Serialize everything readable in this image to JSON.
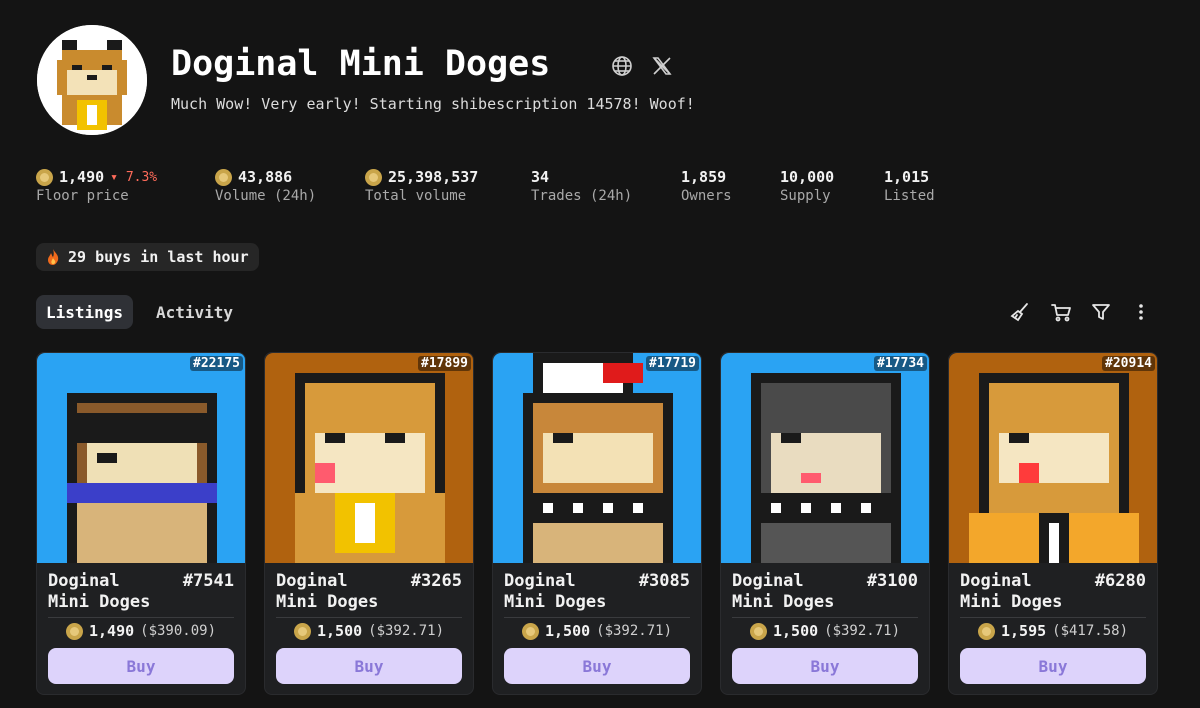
{
  "collection": {
    "title": "Doginal Mini Doges",
    "description": "Much Wow! Very early! Starting shibescription 14578! Woof!"
  },
  "stats": {
    "floor": {
      "value": "1,490",
      "delta": "7.3%",
      "label": "Floor price"
    },
    "volume24": {
      "value": "43,886",
      "label": "Volume (24h)"
    },
    "total_volume": {
      "value": "25,398,537",
      "label": "Total volume"
    },
    "trades": {
      "value": "34",
      "label": "Trades (24h)"
    },
    "owners": {
      "value": "1,859",
      "label": "Owners"
    },
    "supply": {
      "value": "10,000",
      "label": "Supply"
    },
    "listed": {
      "value": "1,015",
      "label": "Listed"
    }
  },
  "buys_pill": "29 buys in last hour",
  "tabs": {
    "listings": "Listings",
    "activity": "Activity"
  },
  "listings": [
    {
      "inscription": "#22175",
      "name": "Doginal Mini Doges",
      "number": "#7541",
      "price": "1,490",
      "usd": "($390.09)",
      "buy": "Buy"
    },
    {
      "inscription": "#17899",
      "name": "Doginal Mini Doges",
      "number": "#3265",
      "price": "1,500",
      "usd": "($392.71)",
      "buy": "Buy"
    },
    {
      "inscription": "#17719",
      "name": "Doginal Mini Doges",
      "number": "#3085",
      "price": "1,500",
      "usd": "($392.71)",
      "buy": "Buy"
    },
    {
      "inscription": "#17734",
      "name": "Doginal Mini Doges",
      "number": "#3100",
      "price": "1,500",
      "usd": "($392.71)",
      "buy": "Buy"
    },
    {
      "inscription": "#20914",
      "name": "Doginal Mini Doges",
      "number": "#6280",
      "price": "1,595",
      "usd": "($417.58)",
      "buy": "Buy"
    }
  ],
  "icons": [
    "globe-icon",
    "x-icon",
    "sweep-icon",
    "cart-icon",
    "filter-icon",
    "more-icon",
    "fire-icon",
    "coin-icon"
  ],
  "colors": {
    "background": "#141414",
    "card": "#1f2022",
    "buy_button": "#ddd3fb",
    "buy_text": "#8a78d8",
    "negative": "#ff6b5a"
  }
}
